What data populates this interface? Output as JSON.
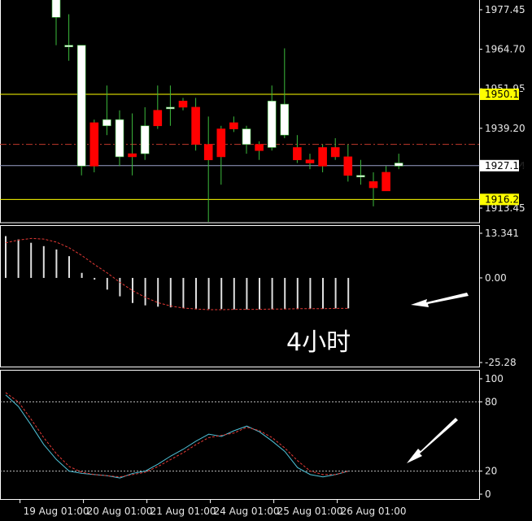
{
  "chart_data": [
    {
      "type": "candlestick",
      "ylim": [
        1909.0,
        1983.0
      ],
      "price_ticks": [
        "1977.45",
        "1964.70",
        "1951.95",
        "1939.20",
        "1927.14",
        "1913.45"
      ],
      "levels": [
        {
          "value": 1950.17,
          "label": "1950.17",
          "color": "#ffff00",
          "style": "solid"
        },
        {
          "value": 1916.25,
          "label": "1916.25",
          "color": "#ffff00",
          "style": "solid"
        },
        {
          "value": 1927.14,
          "label": "1927.14",
          "color": "#9aa0c8",
          "style": "solid"
        },
        {
          "value": 1934.0,
          "label": "",
          "color": "#c0392b",
          "style": "dashdot"
        }
      ],
      "candles": [
        {
          "o": 1975,
          "h": 1985,
          "l": 1966,
          "c": 1985
        },
        {
          "o": 1966,
          "h": 1976,
          "l": 1961,
          "c": 1966
        },
        {
          "o": 1927,
          "h": 1966,
          "l": 1924,
          "c": 1966
        },
        {
          "o": 1941,
          "h": 1942,
          "l": 1925,
          "c": 1927
        },
        {
          "o": 1940,
          "h": 1953,
          "l": 1937,
          "c": 1942
        },
        {
          "o": 1930,
          "h": 1945,
          "l": 1927,
          "c": 1942
        },
        {
          "o": 1931,
          "h": 1944,
          "l": 1924,
          "c": 1930
        },
        {
          "o": 1931,
          "h": 1946,
          "l": 1929,
          "c": 1940
        },
        {
          "o": 1945,
          "h": 1953,
          "l": 1939,
          "c": 1940
        },
        {
          "o": 1946,
          "h": 1953,
          "l": 1940,
          "c": 1946
        },
        {
          "o": 1948,
          "h": 1949,
          "l": 1945,
          "c": 1946
        },
        {
          "o": 1946,
          "h": 1949,
          "l": 1932,
          "c": 1934
        },
        {
          "o": 1934,
          "h": 1943,
          "l": 1909,
          "c": 1929
        },
        {
          "o": 1939,
          "h": 1940,
          "l": 1921,
          "c": 1930
        },
        {
          "o": 1941,
          "h": 1943,
          "l": 1938,
          "c": 1939
        },
        {
          "o": 1934,
          "h": 1940,
          "l": 1931,
          "c": 1939
        },
        {
          "o": 1934,
          "h": 1935,
          "l": 1929,
          "c": 1932
        },
        {
          "o": 1933,
          "h": 1953,
          "l": 1932,
          "c": 1948
        },
        {
          "o": 1937,
          "h": 1965,
          "l": 1936,
          "c": 1947
        },
        {
          "o": 1933,
          "h": 1937,
          "l": 1928,
          "c": 1929
        },
        {
          "o": 1929,
          "h": 1931,
          "l": 1926,
          "c": 1928
        },
        {
          "o": 1933,
          "h": 1934,
          "l": 1925,
          "c": 1927
        },
        {
          "o": 1933,
          "h": 1936,
          "l": 1929,
          "c": 1930
        },
        {
          "o": 1930,
          "h": 1934,
          "l": 1922,
          "c": 1924
        },
        {
          "o": 1924,
          "h": 1929,
          "l": 1921,
          "c": 1924
        },
        {
          "o": 1922,
          "h": 1925,
          "l": 1914,
          "c": 1920
        },
        {
          "o": 1925,
          "h": 1927,
          "l": 1920,
          "c": 1919
        },
        {
          "o": 1927,
          "h": 1931,
          "l": 1926,
          "c": 1928
        }
      ]
    },
    {
      "type": "histogram",
      "ylim": [
        -27.5,
        14.5
      ],
      "ticks": [
        "13.341",
        "0.00",
        "-25.28"
      ],
      "values": [
        12.5,
        11.5,
        10.5,
        9.5,
        8.5,
        6.5,
        1.5,
        -0.5,
        -3.5,
        -5.5,
        -7.5,
        -8.2,
        -8.6,
        -8.8,
        -9.0,
        -9.2,
        -9.3,
        -9.3,
        -9.4,
        -9.4,
        -9.4,
        -9.4,
        -9.3,
        -9.3,
        -9.2,
        -9.2,
        -9.1,
        -9.1
      ],
      "signal": [
        10.5,
        11.3,
        11.8,
        11.6,
        10.7,
        9.0,
        6.7,
        4.0,
        1.5,
        -1.3,
        -3.8,
        -5.8,
        -7.4,
        -8.4,
        -9.0,
        -9.3,
        -9.5,
        -9.5,
        -9.4,
        -9.4,
        -9.4,
        -9.3,
        -9.3,
        -9.2,
        -9.2,
        -9.2,
        -9.1,
        -9.1
      ]
    },
    {
      "type": "line",
      "ylim": [
        0,
        100
      ],
      "ticks": [
        "100",
        "80",
        "20",
        "0"
      ],
      "reference_lines": [
        80,
        20
      ],
      "x_tick_labels": [
        "19 Aug 01:00",
        "20 Aug 01:00",
        "21 Aug 01:00",
        "24 Aug 01:00",
        "25 Aug 01:00",
        "26 Aug 01:00"
      ],
      "x_tick_indices": [
        1,
        6,
        11,
        16,
        21,
        26
      ],
      "series": [
        {
          "color": "#4fc3d9",
          "values": [
            86,
            76,
            60,
            43,
            30,
            20,
            18,
            17,
            16,
            14,
            18,
            20,
            26,
            33,
            39,
            46,
            52,
            50,
            55,
            59,
            54,
            46,
            37,
            23,
            17,
            15,
            17,
            20
          ]
        },
        {
          "color": "#e53935",
          "values": [
            88,
            80,
            65,
            49,
            35,
            24,
            19,
            17,
            16,
            15,
            17,
            19,
            24,
            30,
            36,
            43,
            49,
            51,
            53,
            58,
            55,
            49,
            40,
            29,
            20,
            17,
            17,
            20
          ]
        }
      ]
    }
  ],
  "annotation": {
    "text": "4小时"
  }
}
